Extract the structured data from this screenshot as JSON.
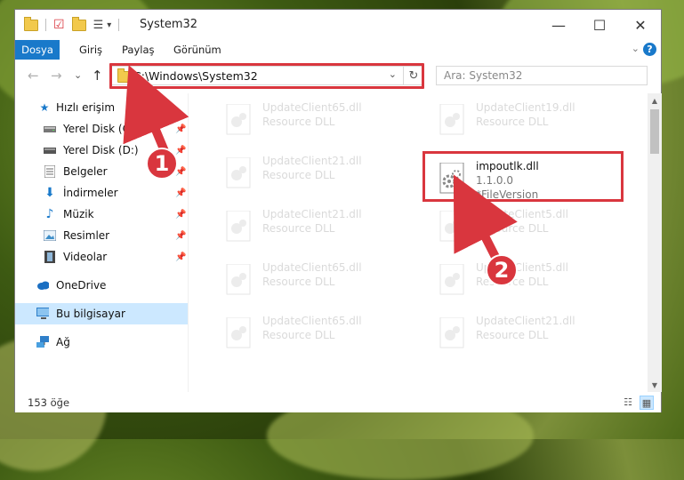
{
  "window": {
    "title": "System32",
    "minimize": "—",
    "maximize": "☐",
    "close": "✕"
  },
  "ribbon": {
    "tabs": [
      "Dosya",
      "Giriş",
      "Paylaş",
      "Görünüm"
    ],
    "expand": "⌄",
    "help": "?"
  },
  "nav": {
    "back": "←",
    "forward": "→",
    "recent": "⌄",
    "up": "↑",
    "address": "C:\\Windows\\System32",
    "address_dropdown": "⌄",
    "refresh": "↻",
    "search_placeholder": "Ara: System32"
  },
  "sidebar": {
    "items": [
      {
        "label": "Hızlı erişim",
        "icon": "star-icon",
        "pinned": false
      },
      {
        "label": "Yerel Disk (C:)",
        "icon": "drive-icon",
        "pinned": true
      },
      {
        "label": "Yerel Disk (D:)",
        "icon": "drive-icon",
        "pinned": true
      },
      {
        "label": "Belgeler",
        "icon": "documents-icon",
        "pinned": true
      },
      {
        "label": "İndirmeler",
        "icon": "download-icon",
        "pinned": true
      },
      {
        "label": "Müzik",
        "icon": "music-icon",
        "pinned": true
      },
      {
        "label": "Resimler",
        "icon": "pictures-icon",
        "pinned": true
      },
      {
        "label": "Videolar",
        "icon": "videos-icon",
        "pinned": true
      },
      {
        "label": "OneDrive",
        "icon": "cloud-icon",
        "pinned": false
      },
      {
        "label": "Bu bilgisayar",
        "icon": "computer-icon",
        "pinned": false,
        "selected": true
      },
      {
        "label": "Ağ",
        "icon": "network-icon",
        "pinned": false
      }
    ],
    "pin_glyph": "📌"
  },
  "files": {
    "faded": [
      {
        "name": "UpdateClient65.dll",
        "desc": "Resource DLL"
      },
      {
        "name": "UpdateClient19.dll",
        "desc": "Resource DLL"
      },
      {
        "name": "UpdateClient21.dll",
        "desc": "Resource DLL"
      },
      {
        "name": "UpdateClient21.dll",
        "desc": "Resource DLL"
      },
      {
        "name": "UpdateClient5.dll",
        "desc": "Resource DLL"
      },
      {
        "name": "UpdateClient65.dll",
        "desc": "Resource DLL"
      },
      {
        "name": "UpdateClient5.dll",
        "desc": "Resource DLL"
      },
      {
        "name": "UpdateClient65.dll",
        "desc": "Resource DLL"
      },
      {
        "name": "UpdateClient21.dll",
        "desc": "Resource DLL"
      }
    ],
    "highlighted": {
      "name": "impoutlk.dll",
      "version": "1.1.0.0",
      "desc": "*FileVersion"
    }
  },
  "status": {
    "count": "153 öğe"
  },
  "callouts": {
    "step1": "1",
    "step2": "2"
  },
  "colors": {
    "accent": "#1979ca",
    "highlight": "#d9363e",
    "selected_bg": "#cce8ff"
  }
}
